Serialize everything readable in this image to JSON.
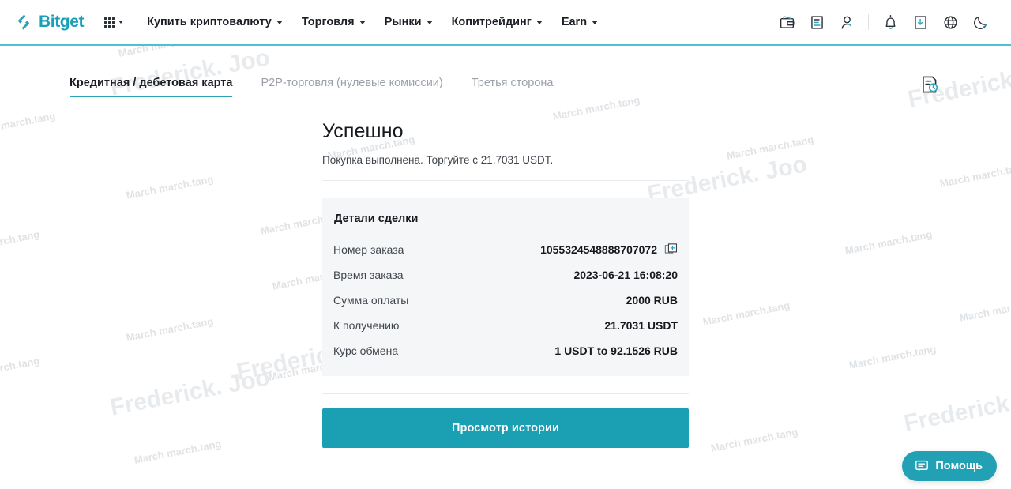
{
  "header": {
    "logo_text": "Bitget",
    "logo_icon": "bitget-logo-icon",
    "apps_icon": "grid-apps-icon",
    "nav": [
      {
        "label": "Купить криптовалюту",
        "has_caret": true
      },
      {
        "label": "Торговля",
        "has_caret": true
      },
      {
        "label": "Рынки",
        "has_caret": true
      },
      {
        "label": "Копитрейдинг",
        "has_caret": true
      },
      {
        "label": "Earn",
        "has_caret": true
      }
    ],
    "icons": [
      {
        "name": "wallet-icon"
      },
      {
        "name": "orders-icon"
      },
      {
        "name": "user-icon"
      },
      {
        "name": "notification-bell-icon"
      },
      {
        "name": "download-app-icon"
      },
      {
        "name": "language-globe-icon"
      },
      {
        "name": "dark-mode-moon-icon"
      }
    ]
  },
  "tabs": {
    "items": [
      {
        "label": "Кредитная / дебетовая карта",
        "active": true
      },
      {
        "label": "P2P-торговля (нулевые комиссии)",
        "active": false
      },
      {
        "label": "Третья сторона",
        "active": false
      }
    ],
    "history_icon": "order-history-icon"
  },
  "main": {
    "title": "Успешно",
    "subtitle": "Покупка выполнена. Торгуйте с 21.7031 USDT.",
    "details": {
      "heading": "Детали сделки",
      "rows": [
        {
          "label": "Номер заказа",
          "value": "1055324548888707072",
          "copy_icon": "copy-icon"
        },
        {
          "label": "Время заказа",
          "value": "2023-06-21 16:08:20"
        },
        {
          "label": "Сумма оплаты",
          "value": "2000 RUB"
        },
        {
          "label": "К получению",
          "value": "21.7031 USDT"
        },
        {
          "label": "Курс обмена",
          "value": "1 USDT to 92.1526 RUB"
        }
      ]
    },
    "primary_button": "Просмотр истории"
  },
  "help": {
    "label": "Помощь",
    "icon": "chat-bubble-icon"
  },
  "watermark": {
    "big": "Frederick. Joo",
    "small": "March march.tang"
  },
  "colors": {
    "accent": "#1a9fb3",
    "accent_light": "#4dc0d3",
    "panel_bg": "#f5f6f7",
    "text": "#15181d",
    "muted": "#9aa1a9"
  }
}
